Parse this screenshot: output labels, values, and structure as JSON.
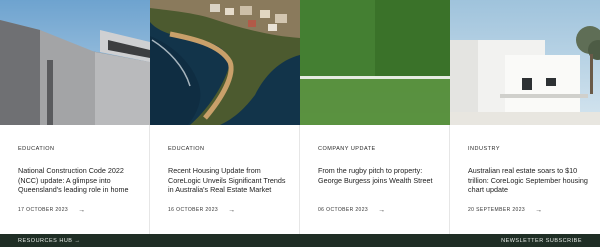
{
  "cards": [
    {
      "category": "EDUCATION",
      "title": "National Construction Code 2022 (NCC) update: A glimpse into Queensland's leading role in home",
      "date": "17 OCTOBER 2023"
    },
    {
      "category": "EDUCATION",
      "title": "Recent Housing Update from CoreLogic Unveils Significant Trends in Australia's Real Estate Market",
      "date": "16 OCTOBER 2023"
    },
    {
      "category": "COMPANY UPDATE",
      "title": "From the rugby pitch to property: George Burgess joins Wealth Street",
      "date": "06 OCTOBER 2023"
    },
    {
      "category": "INDUSTRY",
      "title": "Australian real estate soars to $10 trillion: CoreLogic September housing chart update",
      "date": "20 SEPTEMBER 2023"
    }
  ],
  "icons": {
    "arrow": "arrow-right-icon"
  },
  "footer": {
    "left_link": "RESOURCES HUB",
    "left_arrow": "→",
    "right_link": "NEWSLETTER SUBSCRIBE"
  },
  "colors": {
    "footer_bg": "#1f2e25",
    "footer_text": "#e8ece8"
  }
}
